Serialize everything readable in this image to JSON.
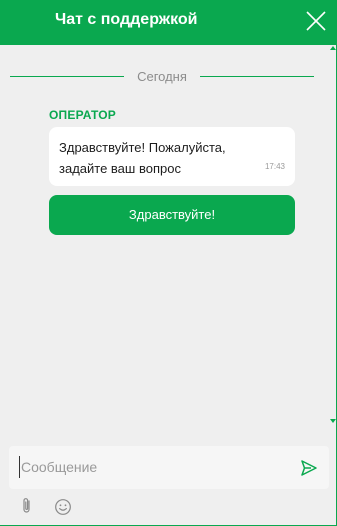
{
  "header": {
    "title": "Чат с поддержкой",
    "close_icon": "close-icon"
  },
  "chat": {
    "date_separator": "Сегодня",
    "messages": [
      {
        "sender": "ОПЕРАТОР",
        "text": "Здравствуйте! Пожалуйста, задайте ваш вопрос",
        "time": "17:43"
      }
    ],
    "quick_reply": "Здравствуйте!"
  },
  "composer": {
    "placeholder": "Сообщение",
    "value": "",
    "send_icon": "send-icon",
    "attach_icon": "paperclip-icon",
    "emoji_icon": "smiley-icon"
  },
  "colors": {
    "accent": "#0aa84f",
    "background": "#efefef",
    "bubble": "#ffffff"
  }
}
